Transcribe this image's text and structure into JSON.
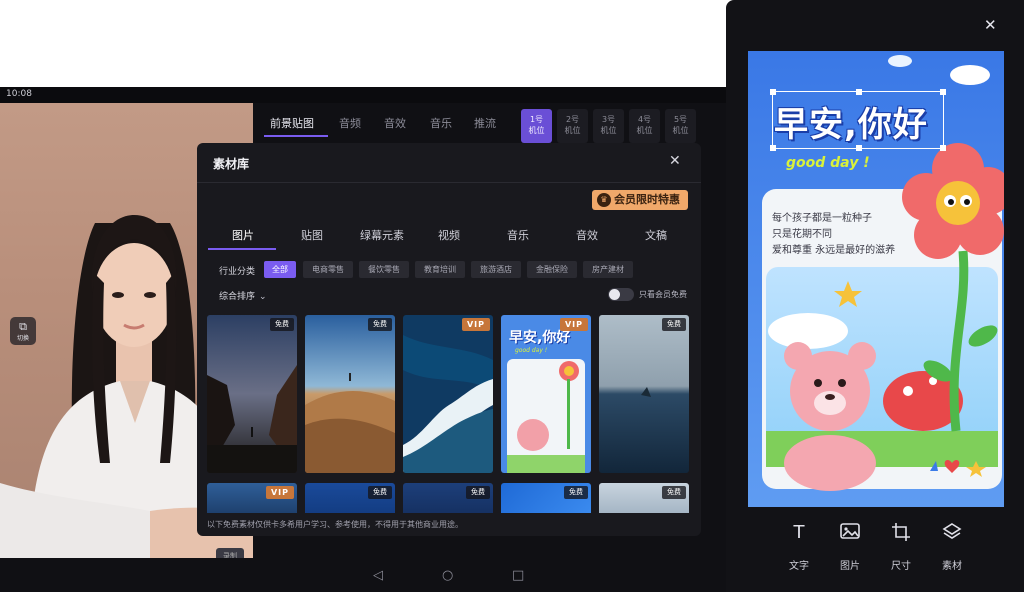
{
  "device": {
    "time": "10:08",
    "switch_label": "切换",
    "record_label": "录制",
    "top_tabs": [
      "前景贴图",
      "音频",
      "音效",
      "音乐",
      "推流"
    ],
    "machines": [
      {
        "num": "1号",
        "label": "机位"
      },
      {
        "num": "2号",
        "label": "机位"
      },
      {
        "num": "3号",
        "label": "机位"
      },
      {
        "num": "4号",
        "label": "机位"
      },
      {
        "num": "5号",
        "label": "机位"
      }
    ],
    "nav_icons": [
      "back-icon",
      "home-icon",
      "recents-icon"
    ]
  },
  "modal": {
    "title": "素材库",
    "vip_promo": "会员限时特惠",
    "categories": [
      "图片",
      "贴图",
      "绿幕元素",
      "视频",
      "音乐",
      "音效",
      "文稿"
    ],
    "industry_label": "行业分类",
    "industries": [
      "全部",
      "电商零售",
      "餐饮零售",
      "教育培训",
      "旅游酒店",
      "金融保险",
      "房产建材"
    ],
    "sort_label": "综合排序",
    "vip_only_label": "只看会员免费",
    "badge_free": "免费",
    "badge_vip": "VIP",
    "thumb_badges_row1": [
      "免费",
      "免费",
      "VIP",
      "VIP",
      "免费"
    ],
    "thumb_badges_row2": [
      "VIP",
      "免费",
      "免费",
      "免费",
      "免费"
    ],
    "thumb_mini_title": "早安,你好",
    "thumb_mini_sub": "good day !",
    "footer": "以下免费素材仅供卡多希用户学习、参考使用，不得用于其他商业用途。"
  },
  "preview": {
    "title": "早安,你好",
    "subtitle": "good day !",
    "lines": [
      "每个孩子都是一粒种子",
      "只是花期不同",
      "爱和尊重 永远是最好的滋养"
    ],
    "tools": [
      {
        "label": "文字",
        "icon": "text-icon"
      },
      {
        "label": "图片",
        "icon": "image-icon"
      },
      {
        "label": "尺寸",
        "icon": "crop-icon"
      },
      {
        "label": "素材",
        "icon": "layers-icon"
      }
    ]
  },
  "colors": {
    "accent": "#7a5cf0",
    "vip_orange": "#f0a86a",
    "modal_bg": "#19191e",
    "poster_blue": "#3f7be8"
  }
}
